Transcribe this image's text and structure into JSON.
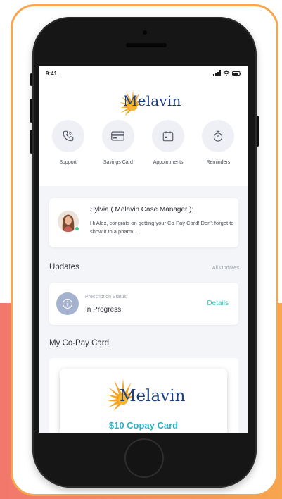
{
  "status_bar": {
    "time": "9:41"
  },
  "header": {
    "brand": "Melavin"
  },
  "actions": [
    {
      "label": "Support",
      "icon": "phone-icon"
    },
    {
      "label": "Savings Card",
      "icon": "card-icon"
    },
    {
      "label": "Appointments",
      "icon": "calendar-icon"
    },
    {
      "label": "Reminders",
      "icon": "timer-icon"
    }
  ],
  "message": {
    "sender": "Sylvia ( Melavin Case Manager ):",
    "text": "Hi Alex, congrats on getting your Co-Pay Card! Don't forget to show it to a pharm..."
  },
  "updates": {
    "title": "Updates",
    "link": "All Updates",
    "prescription_label": "Prescription Status:",
    "prescription_value": "In Progress",
    "details_label": "Details"
  },
  "copay": {
    "title": "My Co-Pay Card",
    "brand": "Melavin",
    "amount": "$10 Copay Card"
  },
  "colors": {
    "accent_orange": "#f7a54e",
    "accent_coral": "#f2776c",
    "teal": "#38c3b8",
    "brand_navy": "#1d3f7c"
  }
}
